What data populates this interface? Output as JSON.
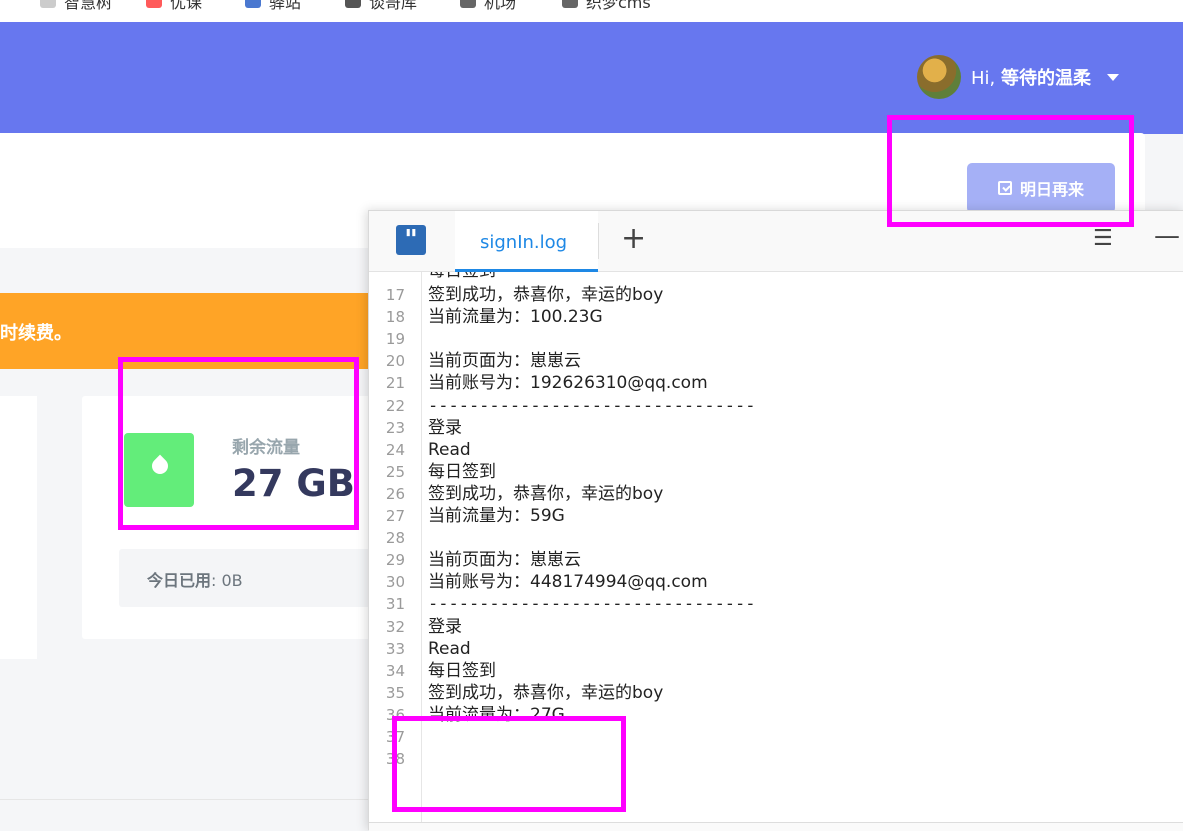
{
  "bookmarks": [
    "智慧树",
    "优课",
    "驿站",
    "谈哥库",
    "机场",
    "织梦cms"
  ],
  "header": {
    "greeting_prefix": "Hi,",
    "username": "等待的温柔",
    "checkin_button": "明日再来"
  },
  "alert": {
    "text": "时续费。"
  },
  "stat": {
    "label": "剩余流量",
    "value": "27 GB",
    "today_label": "今日已用",
    "today_value": ": 0B"
  },
  "editor": {
    "tab": "signIn.log",
    "partial_top_line": "每日签到",
    "lines": [
      {
        "n": "17",
        "text": "签到成功，恭喜你，幸运的boy",
        "mono": false
      },
      {
        "n": "18",
        "text": "当前流量为：100.23G",
        "mono": false
      },
      {
        "n": "19",
        "text": "",
        "mono": false
      },
      {
        "n": "20",
        "text": "当前页面为：崽崽云",
        "mono": false
      },
      {
        "n": "21",
        "text": "当前账号为：192626310@qq.com",
        "mono": false
      },
      {
        "n": "22",
        "text": "--------------------------------",
        "mono": true
      },
      {
        "n": "23",
        "text": "登录",
        "mono": false
      },
      {
        "n": "24",
        "text": "Read",
        "mono": false
      },
      {
        "n": "25",
        "text": "每日签到",
        "mono": false
      },
      {
        "n": "26",
        "text": "签到成功，恭喜你，幸运的boy",
        "mono": false
      },
      {
        "n": "27",
        "text": "当前流量为：59G",
        "mono": false
      },
      {
        "n": "28",
        "text": "",
        "mono": false
      },
      {
        "n": "29",
        "text": "当前页面为：崽崽云",
        "mono": false
      },
      {
        "n": "30",
        "text": "当前账号为：448174994@qq.com",
        "mono": false
      },
      {
        "n": "31",
        "text": "--------------------------------",
        "mono": true
      },
      {
        "n": "32",
        "text": "登录",
        "mono": false
      },
      {
        "n": "33",
        "text": "Read",
        "mono": false
      },
      {
        "n": "34",
        "text": "每日签到",
        "mono": false
      },
      {
        "n": "35",
        "text": "签到成功，恭喜你，幸运的boy",
        "mono": false
      },
      {
        "n": "36",
        "text": "当前流量为：27G",
        "mono": false
      },
      {
        "n": "37",
        "text": "",
        "mono": false
      },
      {
        "n": "38",
        "text": "",
        "mono": false
      }
    ]
  },
  "colors": {
    "header": "#6777ef",
    "alert": "#ffa426",
    "success": "#63ed7a",
    "highlight": "#ff00ff",
    "tab_accent": "#1e88e5"
  },
  "icons": [
    "avatar",
    "caret-down-icon",
    "calendar-check-icon",
    "water-drop-icon",
    "editor-app-icon",
    "plus-icon",
    "hamburger-menu-icon",
    "minimize-icon"
  ]
}
